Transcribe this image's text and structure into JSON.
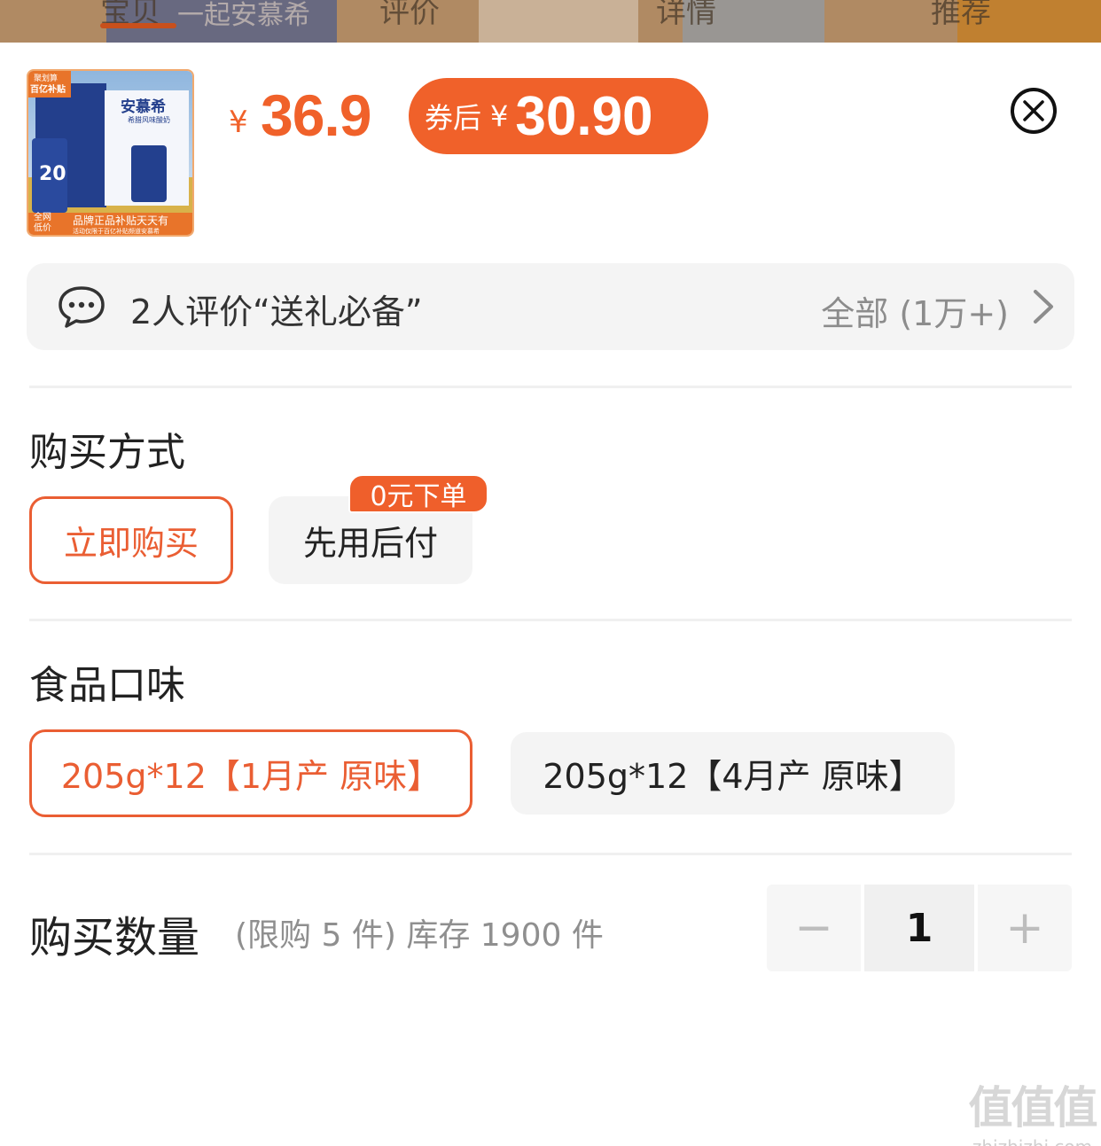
{
  "top_tabs": [
    "宝贝",
    "评价",
    "详情",
    "推荐"
  ],
  "top_banner_text": "一起安慕希",
  "product": {
    "image_name": "product-thumbnail",
    "image_texts": {
      "badge_top_1": "聚划算",
      "badge_top_2": "百亿补贴",
      "brand": "安慕希",
      "flavor": "希腊风味酸奶",
      "number": "20",
      "bottom_tag_1": "全网",
      "bottom_tag_2": "低价",
      "slogan": "品牌正品补贴天天有",
      "sub_slogan": "活动仅限于百亿补贴频道安慕希"
    },
    "price_symbol": "¥",
    "price": "36.9",
    "coupon_label": "券后",
    "coupon_symbol": "¥",
    "coupon_price": "30.90"
  },
  "review": {
    "text": "2人评价“送礼必备”",
    "all_label": "全部 (1万+)"
  },
  "purchase_method": {
    "title": "购买方式",
    "options": [
      "立即购买",
      "先用后付"
    ],
    "badge": "0元下单",
    "selected": 0
  },
  "flavor": {
    "title": "食品口味",
    "options": [
      "205g*12【1月产 原味】",
      "205g*12【4月产 原味】"
    ],
    "selected": 0
  },
  "quantity": {
    "title": "购买数量",
    "hint": "(限购 5 件) 库存 1900 件",
    "value": "1",
    "minus": "−",
    "plus": "+"
  },
  "watermark": {
    "big": "值值值",
    "small": "zhizhizhi.com"
  },
  "colors": {
    "accent": "#f0612a",
    "chip_border": "#ea5e33",
    "chip_bg": "#f4f4f4"
  }
}
